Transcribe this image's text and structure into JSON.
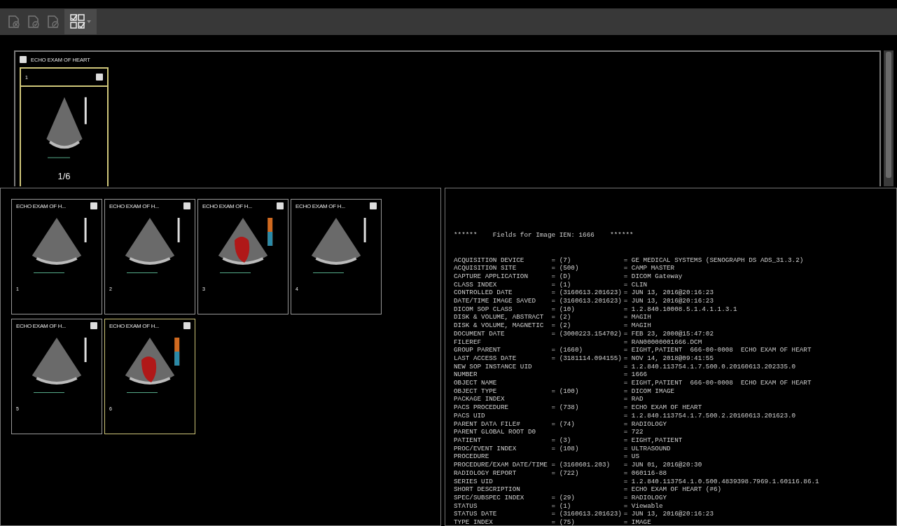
{
  "series_panel": {
    "checked": false,
    "title": "ECHO EXAM OF HEART",
    "studies": [
      {
        "number": "1",
        "checked": false,
        "selected": true,
        "count": "1/6",
        "kind": "grayscale"
      }
    ]
  },
  "images": [
    {
      "title": "ECHO EXAM OF H...",
      "number": "1",
      "checked": false,
      "selected": false,
      "kind": "grayscale"
    },
    {
      "title": "ECHO EXAM OF H...",
      "number": "2",
      "checked": false,
      "selected": false,
      "kind": "grayscale"
    },
    {
      "title": "ECHO EXAM OF H...",
      "number": "3",
      "checked": false,
      "selected": false,
      "kind": "doppler"
    },
    {
      "title": "ECHO EXAM OF H...",
      "number": "4",
      "checked": false,
      "selected": false,
      "kind": "grayscale"
    },
    {
      "title": "ECHO EXAM OF H...",
      "number": "5",
      "checked": false,
      "selected": false,
      "kind": "grayscale"
    },
    {
      "title": "ECHO EXAM OF H...",
      "number": "6",
      "checked": false,
      "selected": true,
      "kind": "doppler"
    }
  ],
  "fields_panel": {
    "header": "******    Fields for Image IEN: 1666    ******",
    "rows": [
      {
        "name": "ACQUISITION DEVICE",
        "code": "= (7)",
        "value": "= GE MEDICAL SYSTEMS (SENOGRAPH DS ADS_31.3.2)"
      },
      {
        "name": "ACQUISITION SITE",
        "code": "= (500)",
        "value": "= CAMP MASTER"
      },
      {
        "name": "CAPTURE APPLICATION",
        "code": "= (D)",
        "value": "= DICOM Gateway"
      },
      {
        "name": "CLASS INDEX",
        "code": "= (1)",
        "value": "= CLIN"
      },
      {
        "name": "CONTROLLED DATE",
        "code": "= (3160613.201623)",
        "value": "= JUN 13, 2016@20:16:23"
      },
      {
        "name": "DATE/TIME IMAGE SAVED",
        "code": "= (3160613.201623)",
        "value": "= JUN 13, 2016@20:16:23"
      },
      {
        "name": "DICOM SOP CLASS",
        "code": "= (10)",
        "value": "= 1.2.840.10008.5.1.4.1.1.3.1"
      },
      {
        "name": "DISK & VOLUME, ABSTRACT",
        "code": "= (2)",
        "value": "= MAGIH"
      },
      {
        "name": "DISK & VOLUME, MAGNETIC",
        "code": "= (2)",
        "value": "= MAGIH"
      },
      {
        "name": "DOCUMENT DATE",
        "code": "= (3000223.154702)",
        "value": "= FEB 23, 2000@15:47:02"
      },
      {
        "name": "FILEREF",
        "value": "= RAN00000001666.DCM"
      },
      {
        "name": "GROUP PARENT",
        "code": "= (1660)",
        "value": "= EIGHT,PATIENT  666-00-0008  ECHO EXAM OF HEART"
      },
      {
        "name": "LAST ACCESS DATE",
        "code": "= (3181114.094155)",
        "value": "= NOV 14, 2018@09:41:55"
      },
      {
        "name": "NEW SOP INSTANCE UID",
        "value": "= 1.2.840.113754.1.7.500.0.20160613.202335.0"
      },
      {
        "name": "NUMBER",
        "value": "= 1666"
      },
      {
        "name": "OBJECT NAME",
        "value": "= EIGHT,PATIENT  666-00-0008  ECHO EXAM OF HEART"
      },
      {
        "name": "OBJECT TYPE",
        "code": "= (100)",
        "value": "= DICOM IMAGE"
      },
      {
        "name": "PACKAGE INDEX",
        "value": "= RAD"
      },
      {
        "name": "PACS PROCEDURE",
        "code": "= (738)",
        "value": "= ECHO EXAM OF HEART"
      },
      {
        "name": "PACS UID",
        "value": "= 1.2.840.113754.1.7.500.2.20160613.201623.0"
      },
      {
        "name": "PARENT DATA FILE#",
        "code": "= (74)",
        "value": "= RADIOLOGY"
      },
      {
        "name": "PARENT GLOBAL ROOT D0",
        "value": "= 722"
      },
      {
        "name": "PATIENT",
        "code": "= (3)",
        "value": "= EIGHT,PATIENT"
      },
      {
        "name": "PROC/EVENT INDEX",
        "code": "= (108)",
        "value": "= ULTRASOUND"
      },
      {
        "name": "PROCEDURE",
        "value": "= US"
      },
      {
        "name": "PROCEDURE/EXAM DATE/TIME",
        "code": "= (3160601.203)",
        "value": "= JUN 01, 2016@20:30"
      },
      {
        "name": "RADIOLOGY REPORT",
        "code": "= (722)",
        "value": "= 060116-88"
      },
      {
        "name": "SERIES UID",
        "value": "= 1.2.840.113754.1.0.500.4839398.7969.1.60116.86.1"
      },
      {
        "name": "SHORT DESCRIPTION",
        "value": "= ECHO EXAM OF HEART (#6)"
      },
      {
        "name": "SPEC/SUBSPEC INDEX",
        "code": "= (29)",
        "value": "= RADIOLOGY"
      },
      {
        "name": "STATUS",
        "code": "= (1)",
        "value": "= Viewable"
      },
      {
        "name": "STATUS DATE",
        "code": "= (3160613.201623)",
        "value": "= JUN 13, 2016@20:16:23"
      },
      {
        "name": "TYPE INDEX",
        "code": "= (75)",
        "value": "= IMAGE"
      }
    ]
  }
}
